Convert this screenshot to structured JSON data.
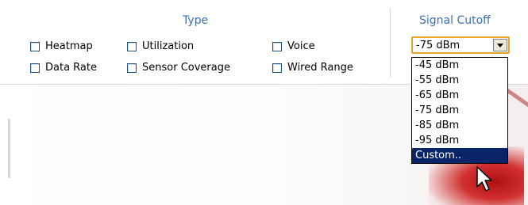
{
  "type_section": {
    "title": "Type",
    "checkboxes": [
      {
        "label": "Heatmap",
        "checked": false
      },
      {
        "label": "Data Rate",
        "checked": false
      },
      {
        "label": "Utilization",
        "checked": false
      },
      {
        "label": "Sensor Coverage",
        "checked": false
      },
      {
        "label": "Voice",
        "checked": false
      },
      {
        "label": "Wired Range",
        "checked": false
      }
    ]
  },
  "signal_section": {
    "title": "Signal Cutoff",
    "selected_value": "-75 dBm",
    "dropdown_arrow_icon": "triangle-down",
    "options": [
      "-45 dBm",
      "-55 dBm",
      "-65 dBm",
      "-75 dBm",
      "-85 dBm",
      "-95 dBm",
      "Custom.."
    ],
    "highlighted_option": "Custom.."
  },
  "colors": {
    "section_title": "#3d6fb6",
    "select_border": "#e6a52a",
    "highlight": "#0a246a"
  },
  "cursor_icon": "arrow-pointer"
}
